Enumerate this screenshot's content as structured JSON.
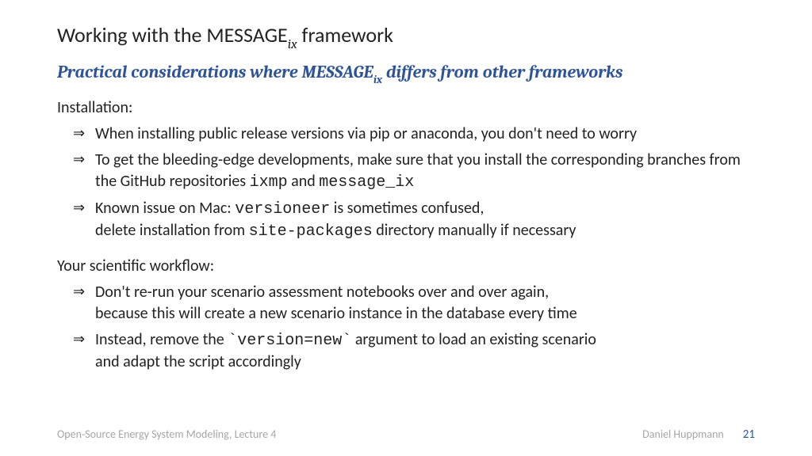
{
  "title_pre": "Working with the MESSAGE",
  "title_sub": "ix",
  "title_post": " framework",
  "subtitle_pre": "Practical considerations where MESSAGE",
  "subtitle_sub": "ix",
  "subtitle_post": " differs from other frameworks",
  "section1": "Installation:",
  "bullets1": {
    "b0": "When installing public release versions via pip or anaconda, you don't need to worry",
    "b1_pre": "To get the bleeding-edge developments, make sure that you install the corresponding branches from the GitHub repositories ",
    "b1_code1": "ixmp",
    "b1_mid": " and ",
    "b1_code2": "message_ix",
    "b2_pre": "Known issue on Mac: ",
    "b2_code1": "versioneer",
    "b2_mid": " is sometimes confused,",
    "b2_line2_pre": "delete installation from ",
    "b2_code2": "site-packages",
    "b2_line2_post": " directory manually if necessary"
  },
  "section2": "Your scientific workflow:",
  "bullets2": {
    "b0_line1": "Don't re-run your scenario assessment notebooks over and over again,",
    "b0_line2": "because this will create a new scenario instance in the database every time",
    "b1_pre": "Instead, remove the ",
    "b1_code": "`version=new`",
    "b1_post": " argument to load an existing scenario",
    "b1_line2": "and adapt the script accordingly"
  },
  "footer": {
    "left": "Open-Source Energy System Modeling, Lecture 4",
    "author": "Daniel Huppmann",
    "page": "21"
  }
}
